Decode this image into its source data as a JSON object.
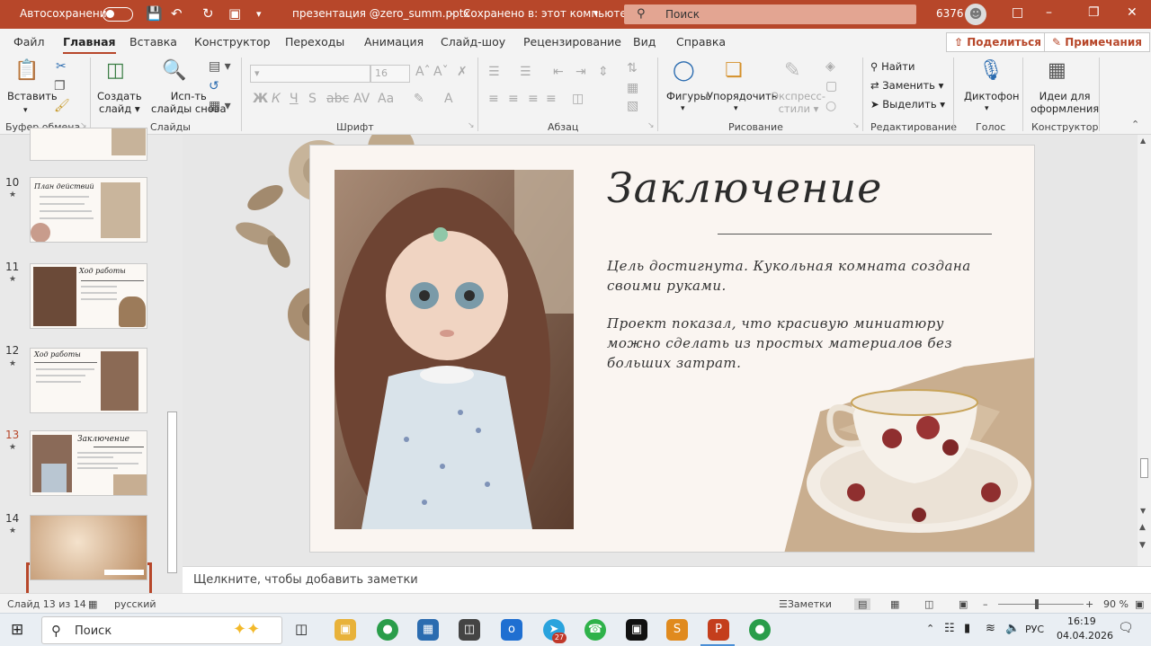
{
  "titlebar": {
    "autosave_label": "Автосохранение",
    "filename": "презентация @zero_summ.pptx",
    "save_status": "Сохранено в: этот компьютер",
    "search_placeholder": "Поиск",
    "user_id": "6376"
  },
  "tabs": [
    "Файл",
    "Главная",
    "Вставка",
    "Конструктор",
    "Переходы",
    "Анимация",
    "Слайд-шоу",
    "Рецензирование",
    "Вид",
    "Справка"
  ],
  "actions": {
    "share": "Поделиться",
    "comments": "Примечания"
  },
  "ribbon": {
    "paste": "Вставить",
    "new_slide": [
      "Создать",
      "слайд"
    ],
    "reuse": [
      "Исп-ть",
      "слайды снова"
    ],
    "font_size": "16",
    "shapes": "Фигуры",
    "arrange": "Упорядочить",
    "quick_styles": [
      "Экспресс-",
      "стили"
    ],
    "find": "Найти",
    "replace": "Заменить",
    "select": "Выделить",
    "dictate": "Диктофон",
    "designer": [
      "Идеи для",
      "оформления"
    ],
    "groups": {
      "clipboard": "Буфер обмена",
      "slides": "Слайды",
      "font": "Шрифт",
      "paragraph": "Абзац",
      "drawing": "Рисование",
      "editing": "Редактирование",
      "voice": "Голос",
      "designer": "Конструктор"
    }
  },
  "thumbnails": [
    {
      "num": "10",
      "title": "План действий"
    },
    {
      "num": "11",
      "title": "Ход работы"
    },
    {
      "num": "12",
      "title": "Ход работы"
    },
    {
      "num": "13",
      "title": "Заключение"
    },
    {
      "num": "14",
      "title": ""
    }
  ],
  "slide": {
    "title": "Заключение",
    "para1": "Цель достигнута. Кукольная комната создана своими руками.",
    "para2": "Проект показал, что красивую миниатюру можно сделать из простых материалов без больших затрат."
  },
  "notes_placeholder": "Щелкните, чтобы добавить заметки",
  "status": {
    "slide_counter": "Слайд 13 из 14",
    "language": "русский",
    "notes_btn": "Заметки",
    "zoom": "90 %"
  },
  "taskbar": {
    "search": "Поиск",
    "lang": "РУС",
    "time": "16:19",
    "date": "04.04.2026",
    "telegram_badge": "27"
  },
  "colors": {
    "accent": "#b7472a",
    "slide_bg": "#faf5f1"
  }
}
